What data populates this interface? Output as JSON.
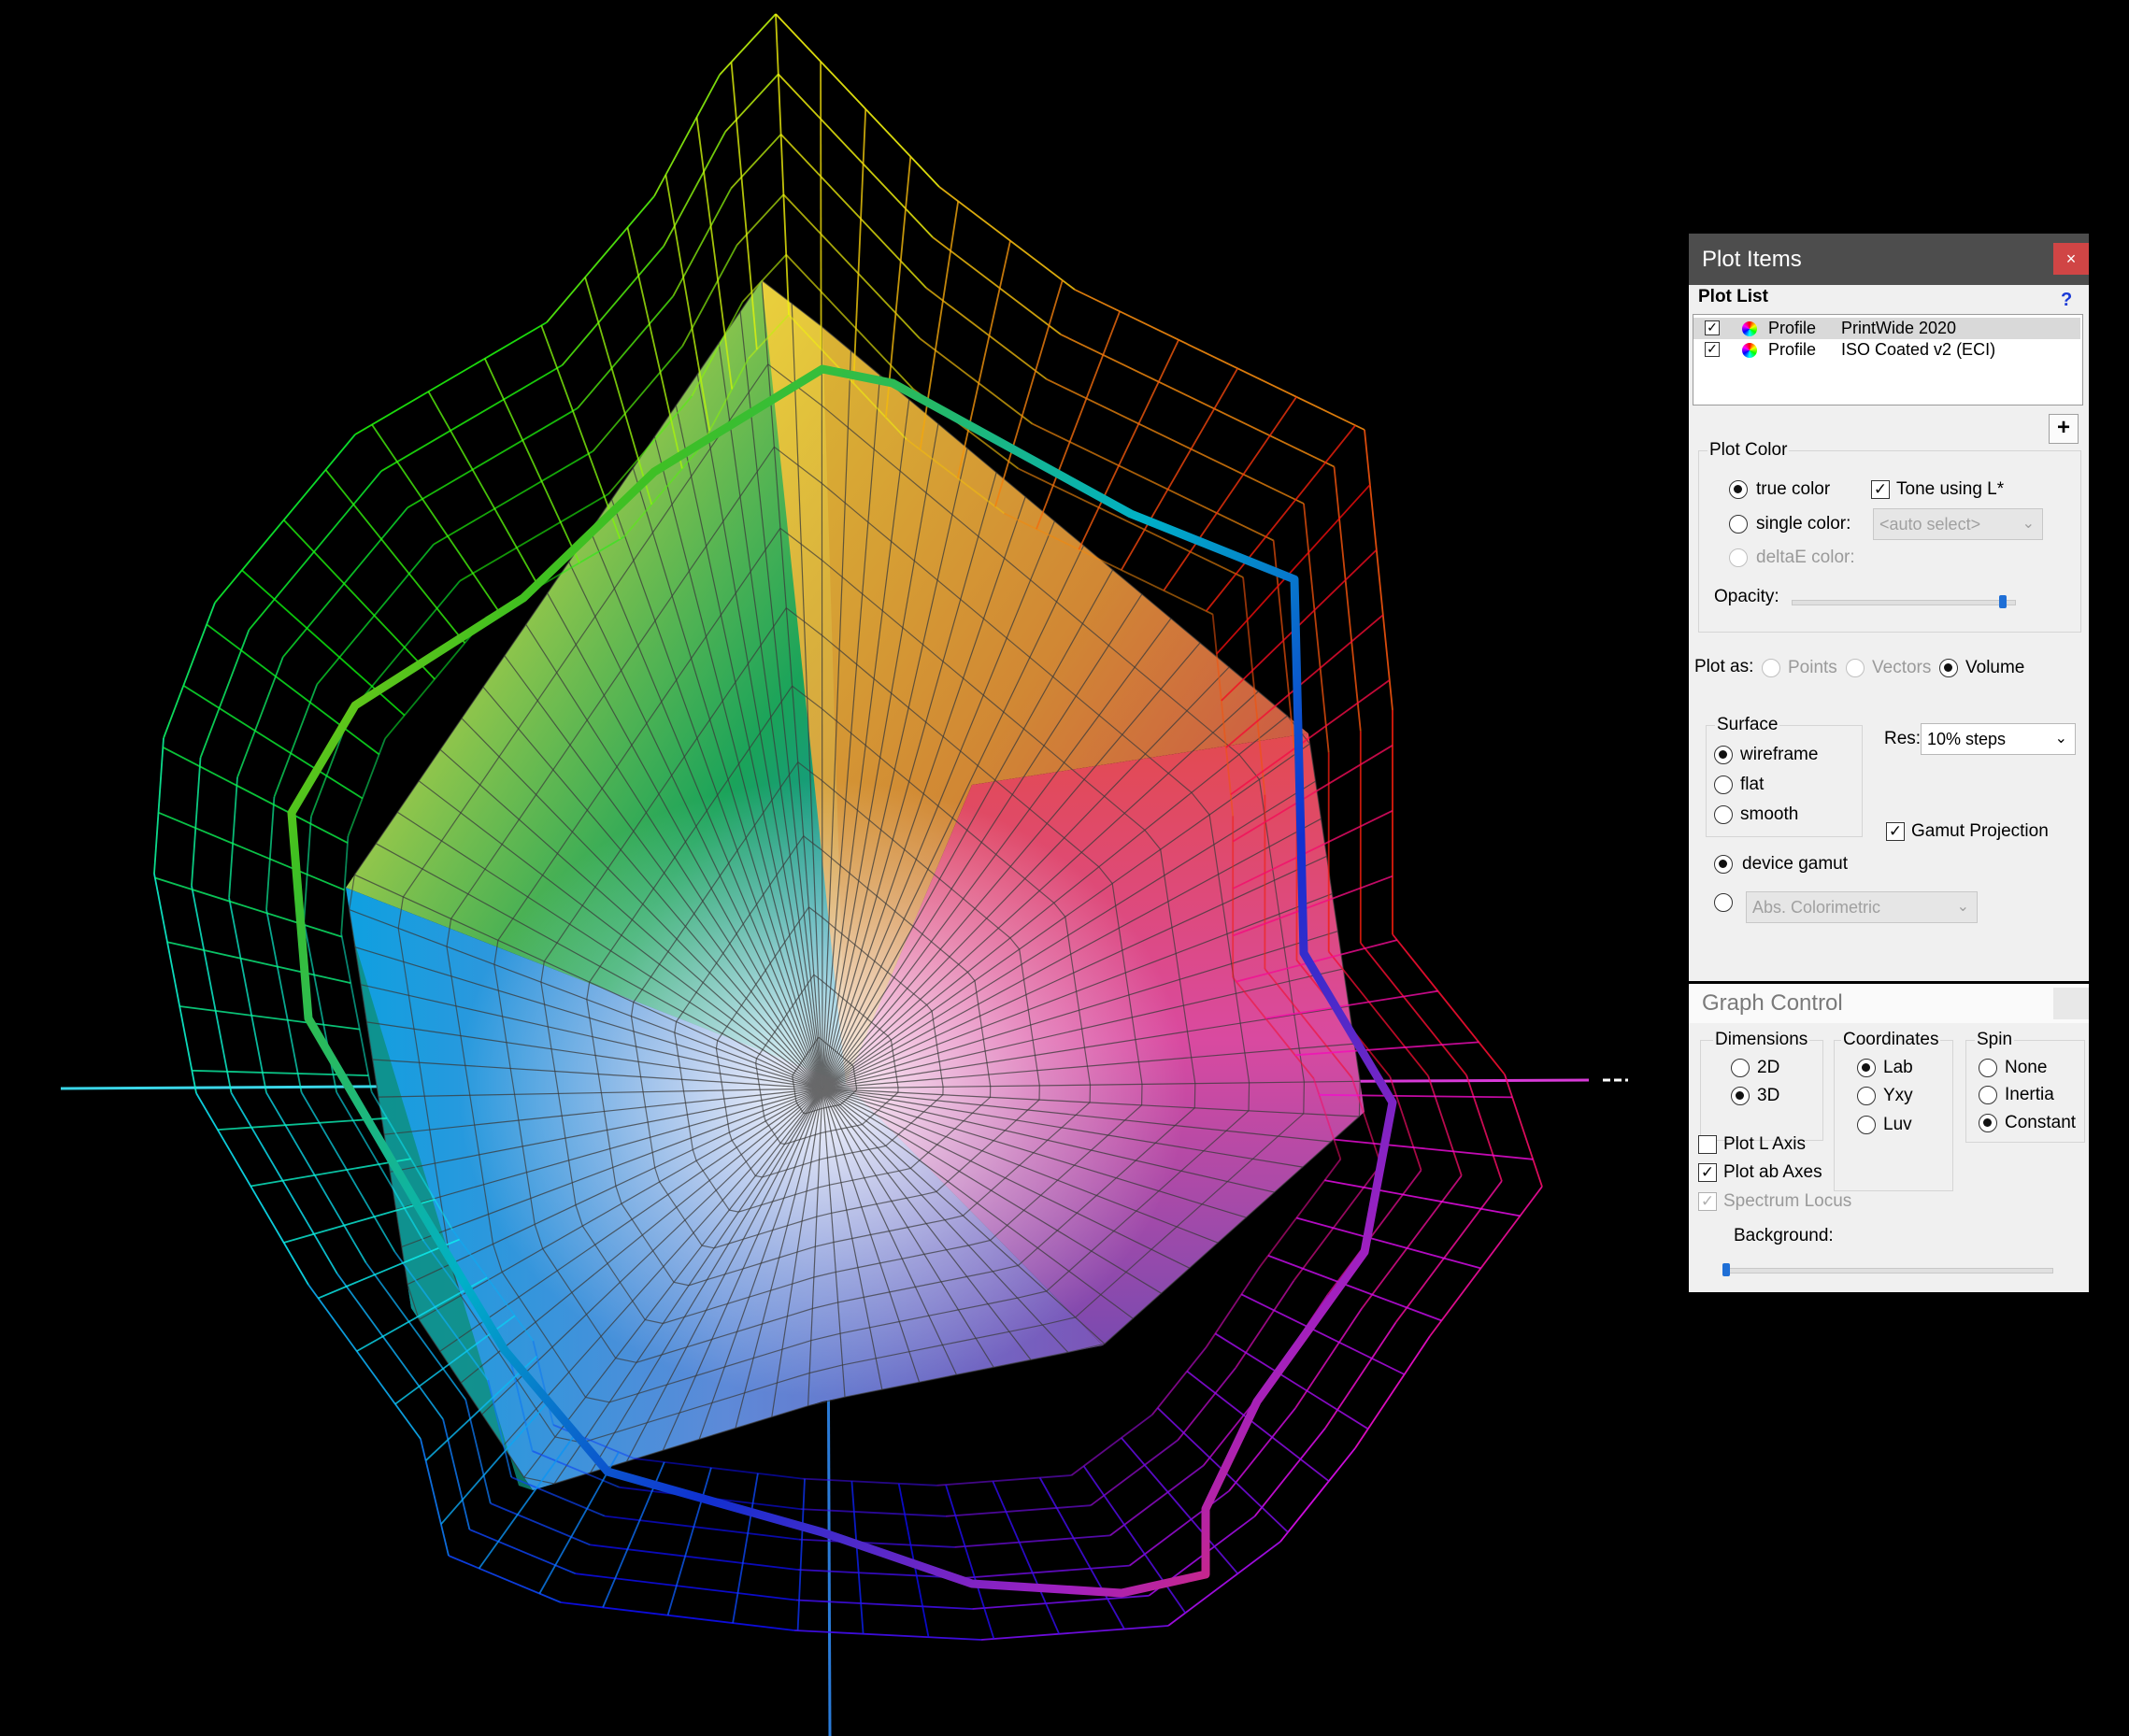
{
  "plot_items": {
    "title": "Plot Items",
    "close_label": "×",
    "plot_list_label": "Plot List",
    "help_label": "?",
    "items": [
      {
        "checked": true,
        "type": "Profile",
        "name": "PrintWide 2020",
        "selected": true
      },
      {
        "checked": true,
        "type": "Profile",
        "name": "ISO Coated v2 (ECI)",
        "selected": false
      }
    ],
    "add_button": "+",
    "plot_color": {
      "label": "Plot Color",
      "true_color": "true color",
      "single_color": "single color:",
      "single_color_select": "<auto select>",
      "deltaE_color": "deltaE color:",
      "tone_using": "Tone using L*",
      "tone_checked": true,
      "selected": "true color",
      "opacity_label": "Opacity:",
      "opacity_value": 0.95
    },
    "plot_as": {
      "label": "Plot as:",
      "options": [
        "Points",
        "Vectors",
        "Volume"
      ],
      "selected": "Volume"
    },
    "surface": {
      "label": "Surface",
      "options": [
        "wireframe",
        "flat",
        "smooth"
      ],
      "selected": "wireframe"
    },
    "res": {
      "label": "Res:",
      "value": "10% steps"
    },
    "gamut_projection": {
      "label": "Gamut Projection",
      "checked": true
    },
    "device_gamut": {
      "label": "device gamut",
      "selected": true
    },
    "intent": {
      "value": "Abs. Colorimetric"
    }
  },
  "graph_control": {
    "title": "Graph Control",
    "dimensions": {
      "label": "Dimensions",
      "options": [
        "2D",
        "3D"
      ],
      "selected": "3D"
    },
    "coordinates": {
      "label": "Coordinates",
      "options": [
        "Lab",
        "Yxy",
        "Luv"
      ],
      "selected": "Lab"
    },
    "spin": {
      "label": "Spin",
      "options": [
        "None",
        "Inertia",
        "Constant"
      ],
      "selected": "Constant"
    },
    "plot_l_axis": {
      "label": "Plot L Axis",
      "checked": false
    },
    "plot_ab_axes": {
      "label": "Plot ab Axes",
      "checked": true
    },
    "spectrum_locus": {
      "label": "Spectrum Locus",
      "checked": true
    },
    "background_label": "Background:",
    "background_value": 0.0
  },
  "colors": {
    "window_bg": "#000000",
    "panel_bg": "#f0f0f0",
    "title_active": "#4d4d4d",
    "close_red": "#d04545",
    "slider_blue": "#1f6fd6"
  }
}
